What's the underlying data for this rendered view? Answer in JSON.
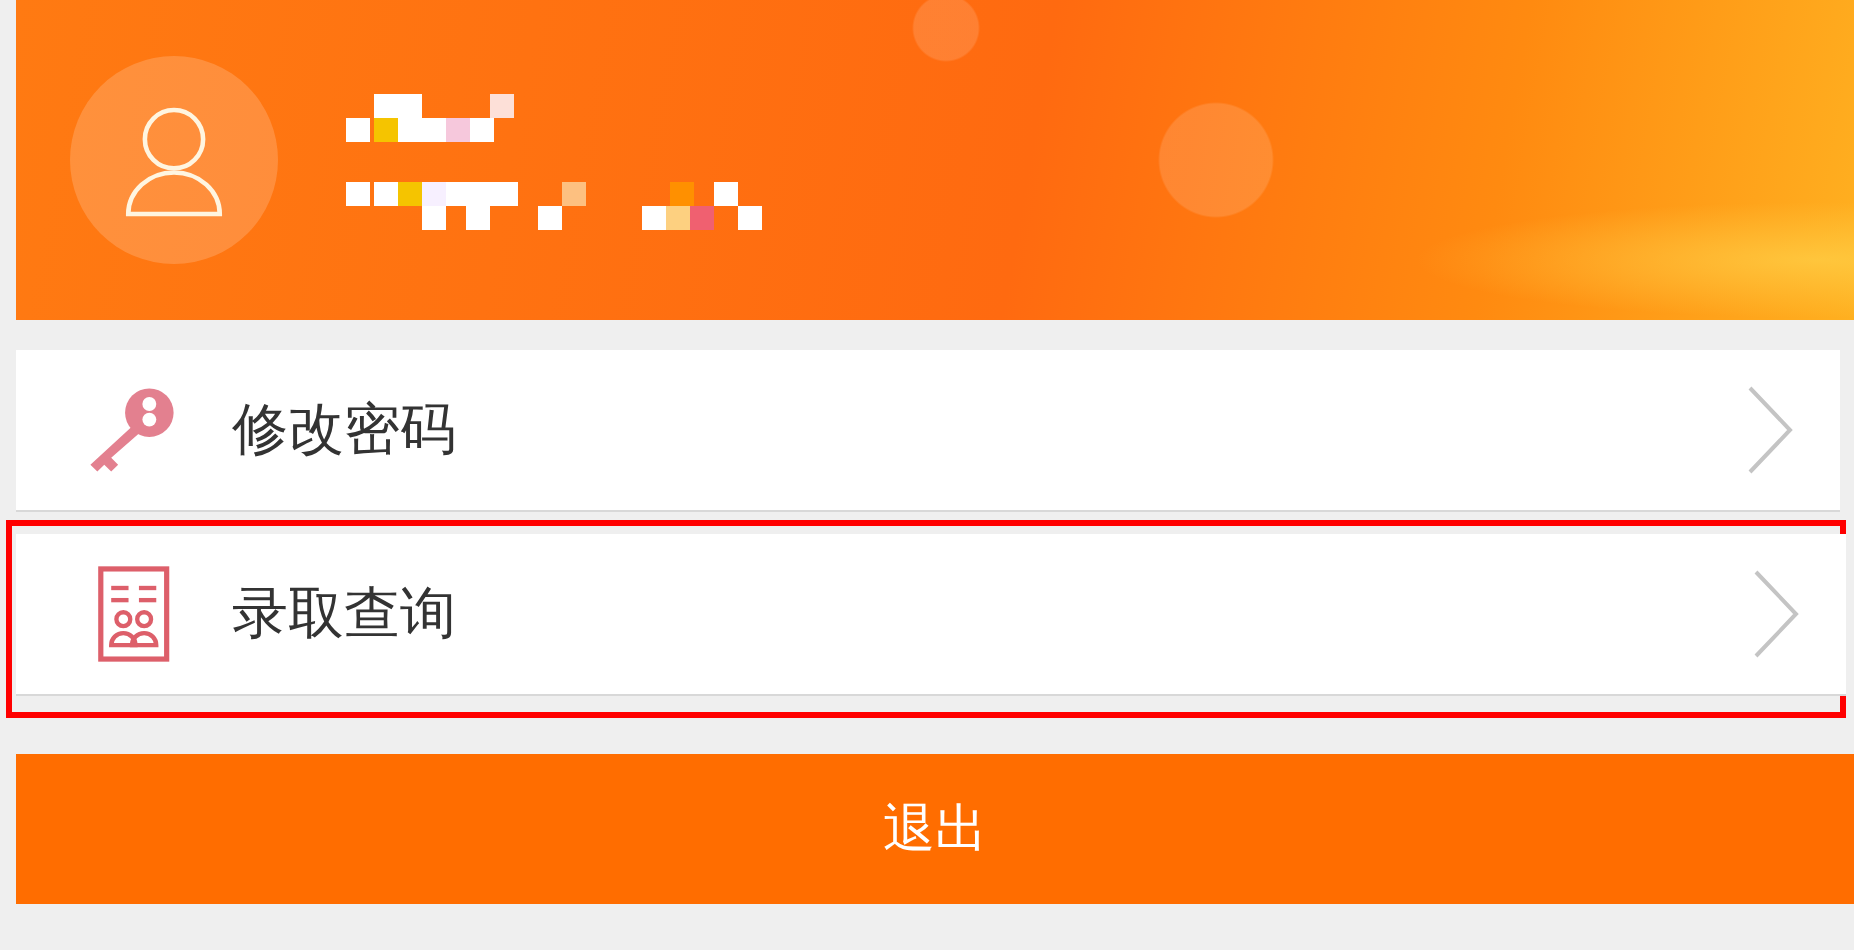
{
  "profile": {
    "name_redacted": true,
    "detail_redacted": true
  },
  "menu": [
    {
      "kind": "key",
      "label": "修改密码",
      "highlighted": false
    },
    {
      "kind": "admission",
      "label": "录取查询",
      "highlighted": true
    }
  ],
  "logout_button": {
    "label": "退出"
  }
}
